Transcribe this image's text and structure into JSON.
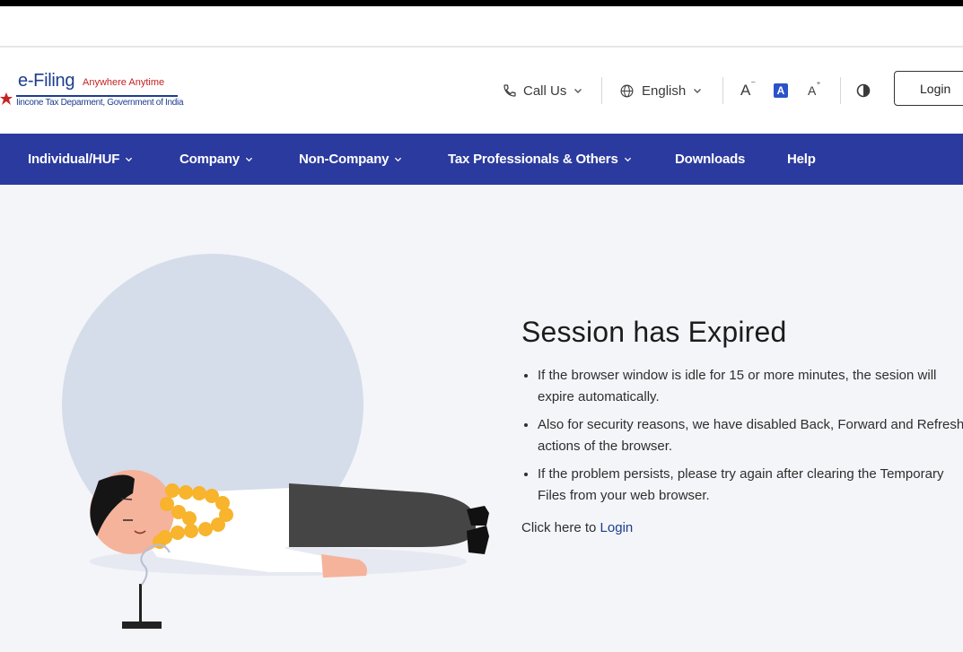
{
  "logo": {
    "brand": "e-Filing",
    "tagline": "Anywhere Anytime",
    "department": "Iincone Tax Deparment, Government of India"
  },
  "header": {
    "call_us": "Call Us",
    "language": "English",
    "font_decrease": "A",
    "font_normal": "A",
    "font_increase": "A",
    "login": "Login"
  },
  "nav": {
    "items": [
      {
        "label": "Individual/HUF",
        "has_dropdown": true
      },
      {
        "label": "Company",
        "has_dropdown": true
      },
      {
        "label": "Non-Company",
        "has_dropdown": true
      },
      {
        "label": "Tax Professionals & Others",
        "has_dropdown": true
      },
      {
        "label": "Downloads",
        "has_dropdown": false
      },
      {
        "label": "Help",
        "has_dropdown": false
      }
    ]
  },
  "message": {
    "title": "Session has Expired",
    "bullets": [
      {
        "line1": "If the browser window is idle for 15 or more minutes, the sesion will",
        "line2": "expire automatically."
      },
      {
        "line1": "Also for security reasons, we have disabled Back, Forward and Refresh",
        "line2": "actions of the browser."
      },
      {
        "line1": "If the problem persists, please try again after clearing the Temporary",
        "line2": "Files from your web browser."
      }
    ],
    "cta_prefix": "Click here to ",
    "cta_link": "Login"
  },
  "colors": {
    "nav_bg": "#2b3a9e",
    "brand_blue": "#1d3d8f",
    "brand_red": "#c62222",
    "page_bg": "#f4f5f9",
    "illustration_circle": "#d5dcea"
  },
  "icons": {
    "call": "phone-icon",
    "language": "globe-icon",
    "contrast": "contrast-icon",
    "dropdown": "chevron-down-icon"
  }
}
